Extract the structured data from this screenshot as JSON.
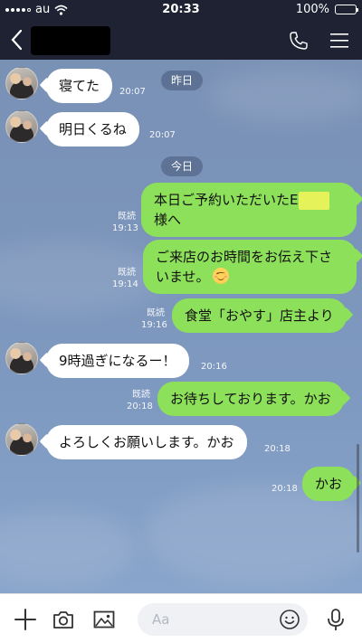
{
  "status_bar": {
    "carrier": "au",
    "time": "20:33",
    "battery": "100%",
    "battery_level": 1.0
  },
  "header": {
    "chat_name": "",
    "back_icon": "chevron-left-icon",
    "call_icon": "phone-icon",
    "menu_icon": "hamburger-menu-icon"
  },
  "dates": {
    "yesterday": "昨日",
    "today": "今日"
  },
  "messages": [
    {
      "side": "in",
      "text": "寝てた",
      "time": "20:07"
    },
    {
      "side": "in",
      "text": "明日くるね",
      "time": "20:07"
    },
    {
      "side": "out",
      "line1": "本日ご予約いただいたE",
      "line2": "様へ",
      "read": "既読",
      "time": "19:13"
    },
    {
      "side": "out",
      "line1": "ご来店のお時間をお伝え下さ",
      "line2": "いませ。",
      "read": "既読",
      "time": "19:14"
    },
    {
      "side": "out",
      "text": "食堂「おやす」店主より",
      "read": "既読",
      "time": "19:16"
    },
    {
      "side": "in",
      "text": "9時過ぎになるー！",
      "time": "20:16"
    },
    {
      "side": "out",
      "text": "お待ちしております。かお",
      "read": "既読",
      "time": "20:18"
    },
    {
      "side": "in",
      "text": "よろしくお願いします。かお",
      "time": "20:18"
    },
    {
      "side": "out",
      "text": "かお",
      "time": "20:18"
    }
  ],
  "input_bar": {
    "placeholder": "Aa",
    "icons": [
      "plus-icon",
      "camera-icon",
      "image-icon",
      "emoji-icon",
      "microphone-icon"
    ]
  },
  "colors": {
    "header_bg": "#1e2233",
    "chat_bg": "#7b94ba",
    "out_bubble": "#8de05a",
    "in_bubble": "#ffffff"
  }
}
